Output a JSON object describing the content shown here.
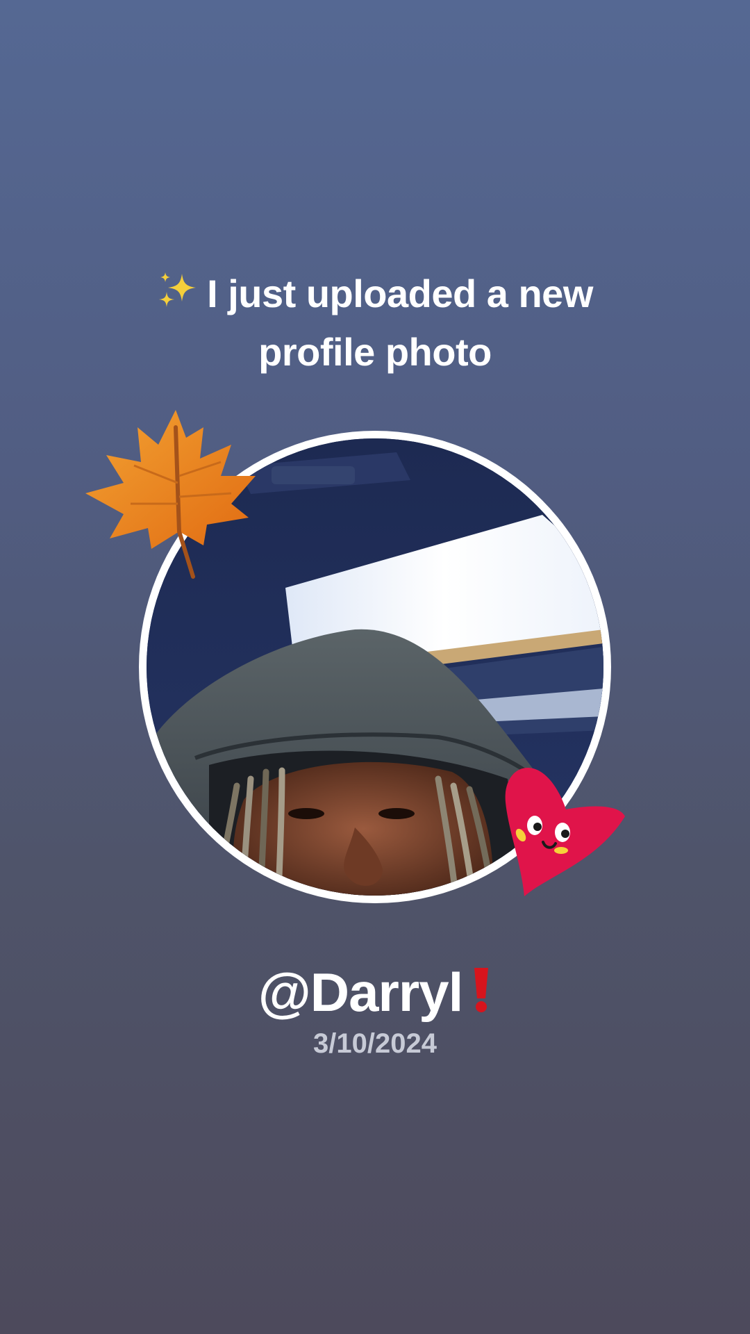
{
  "post": {
    "headline_line1": "I just uploaded a new",
    "headline_line2": "profile photo",
    "username": "@Darryl",
    "date": "3/10/2024"
  },
  "stickers": {
    "headline_icon": "sparkles-icon",
    "top_left": "maple-leaf-sticker",
    "bottom_right": "heart-face-sticker",
    "after_username": "exclamation-icon"
  },
  "colors": {
    "background_top": "#556893",
    "background_bottom": "#4d4a5c",
    "text": "#ffffff",
    "date_text": "#c7cad6",
    "photo_ring": "#ffffff",
    "heart": "#e0144a",
    "leaf": "#ee8a1c",
    "exclaim": "#d7141d"
  }
}
